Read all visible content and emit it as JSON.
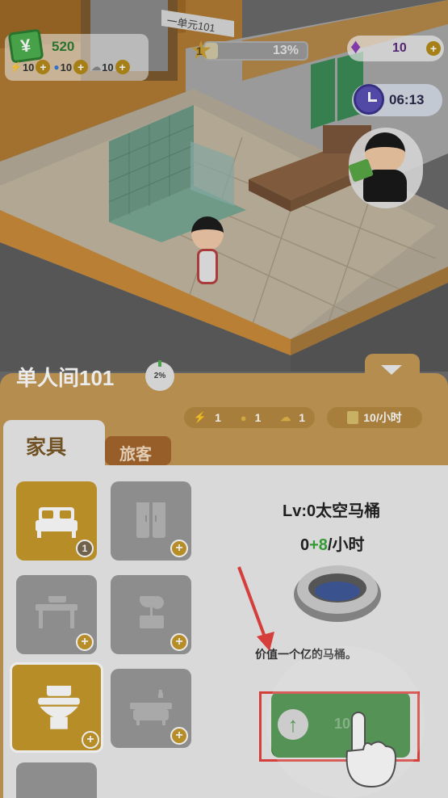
{
  "hud": {
    "money": "520",
    "money_symbol": "¥",
    "energy": "10",
    "water": "10",
    "cloud": "10",
    "level_num": "1",
    "level_progress": "13%",
    "level_fraction": 0.13,
    "gems": "10",
    "timer": "06:13"
  },
  "scene": {
    "sign_text": "一单元101"
  },
  "panel": {
    "room_title": "单人间101",
    "room_progress": "2%",
    "stat_energy": "1",
    "stat_water": "1",
    "stat_cloud": "1",
    "income": "10/小时",
    "tab_furniture": "家具",
    "tab_guests": "旅客",
    "bed_count": "1"
  },
  "detail": {
    "title": "Lv:0太空马桶",
    "rate_base": "0",
    "rate_plus": "+8",
    "rate_unit": "/小时",
    "description": "价值一个亿的马桶。",
    "cost": "10"
  },
  "icons": {
    "energy": "lightning-icon",
    "water": "drop-icon",
    "cloud": "cloud-icon"
  },
  "colors": {
    "panel": "#c49956",
    "accent": "#c79a2c",
    "upgrade": "#3a8a3a",
    "highlight": "#e8443f"
  }
}
